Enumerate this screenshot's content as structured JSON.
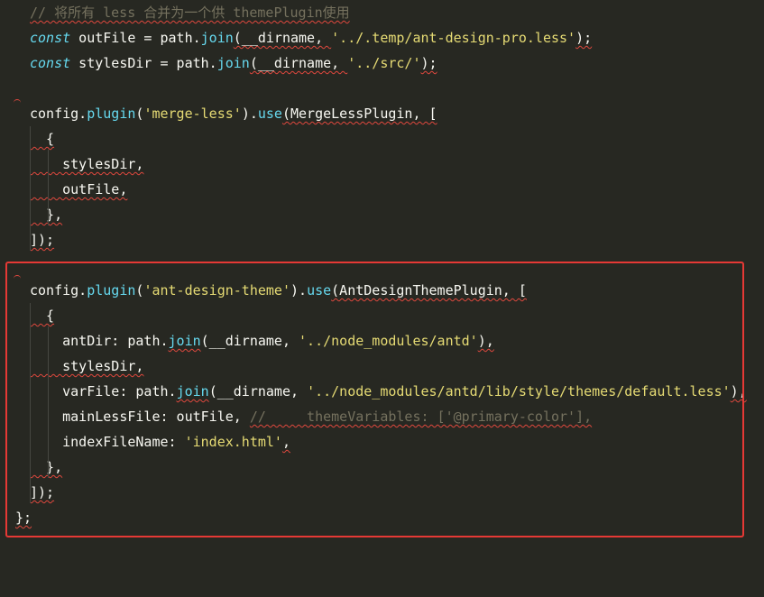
{
  "lines": [
    {
      "tokens": [
        {
          "t": "comment",
          "v": "// 将所有 less 合并为一个供 themePlugin使用"
        }
      ]
    },
    {
      "tokens": [
        {
          "t": "kw",
          "v": "const"
        },
        {
          "t": "plain",
          "v": " outFile = path."
        },
        {
          "t": "fn",
          "v": "join"
        },
        {
          "t": "plain",
          "v": "(__dirname, "
        },
        {
          "t": "str",
          "v": "'../.temp/ant-design-pro.less'"
        },
        {
          "t": "plain",
          "v": ");"
        }
      ]
    },
    {
      "tokens": [
        {
          "t": "kw",
          "v": "const"
        },
        {
          "t": "plain",
          "v": " stylesDir = path."
        },
        {
          "t": "fn",
          "v": "join"
        },
        {
          "t": "plain",
          "v": "(__dirname, "
        },
        {
          "t": "str",
          "v": "'../src/'"
        },
        {
          "t": "plain",
          "v": ");"
        }
      ]
    },
    {
      "tokens": []
    },
    {
      "tokens": [
        {
          "t": "plain",
          "v": "config."
        },
        {
          "t": "fn",
          "v": "plugin"
        },
        {
          "t": "plain",
          "v": "("
        },
        {
          "t": "str",
          "v": "'merge-less'"
        },
        {
          "t": "plain",
          "v": ")."
        },
        {
          "t": "fn",
          "v": "use"
        },
        {
          "t": "plain",
          "v": "(MergeLessPlugin, ["
        }
      ]
    },
    {
      "tokens": [
        {
          "t": "plain",
          "v": "  {"
        }
      ]
    },
    {
      "tokens": [
        {
          "t": "plain",
          "v": "    stylesDir,"
        }
      ]
    },
    {
      "tokens": [
        {
          "t": "plain",
          "v": "    outFile,"
        }
      ]
    },
    {
      "tokens": [
        {
          "t": "plain",
          "v": "  },"
        }
      ]
    },
    {
      "tokens": [
        {
          "t": "plain",
          "v": "]);"
        }
      ]
    },
    {
      "tokens": []
    },
    {
      "tokens": [
        {
          "t": "plain",
          "v": "config."
        },
        {
          "t": "fn",
          "v": "plugin"
        },
        {
          "t": "plain",
          "v": "("
        },
        {
          "t": "str",
          "v": "'ant-design-theme'"
        },
        {
          "t": "plain",
          "v": ")."
        },
        {
          "t": "fn",
          "v": "use"
        },
        {
          "t": "plain",
          "v": "(AntDesignThemePlugin, ["
        }
      ]
    },
    {
      "tokens": [
        {
          "t": "plain",
          "v": "  {"
        }
      ]
    },
    {
      "tokens": [
        {
          "t": "plain",
          "v": "    antDir: path."
        },
        {
          "t": "fn",
          "v": "join"
        },
        {
          "t": "plain",
          "v": "(__dirname, "
        },
        {
          "t": "str",
          "v": "'../node_modules/antd'"
        },
        {
          "t": "plain",
          "v": "),"
        }
      ]
    },
    {
      "tokens": [
        {
          "t": "plain",
          "v": "    stylesDir,"
        }
      ]
    },
    {
      "tokens": [
        {
          "t": "plain",
          "v": "    varFile: path."
        },
        {
          "t": "fn",
          "v": "join"
        },
        {
          "t": "plain",
          "v": "(__dirname, "
        },
        {
          "t": "str",
          "v": "'../node_modules/antd/lib/style/themes/default.less'"
        },
        {
          "t": "plain",
          "v": "),"
        }
      ]
    },
    {
      "tokens": [
        {
          "t": "plain",
          "v": "    mainLessFile: outFile, "
        },
        {
          "t": "comment",
          "v": "//     themeVariables: ['@primary-color'],"
        }
      ]
    },
    {
      "tokens": [
        {
          "t": "plain",
          "v": "    indexFileName: "
        },
        {
          "t": "str",
          "v": "'index.html'"
        },
        {
          "t": "plain",
          "v": ","
        }
      ]
    },
    {
      "tokens": [
        {
          "t": "plain",
          "v": "  },"
        }
      ]
    },
    {
      "tokens": [
        {
          "t": "plain",
          "v": "]);"
        }
      ]
    },
    {
      "tokens": [
        {
          "t": "plain",
          "v": "};"
        }
      ]
    }
  ]
}
